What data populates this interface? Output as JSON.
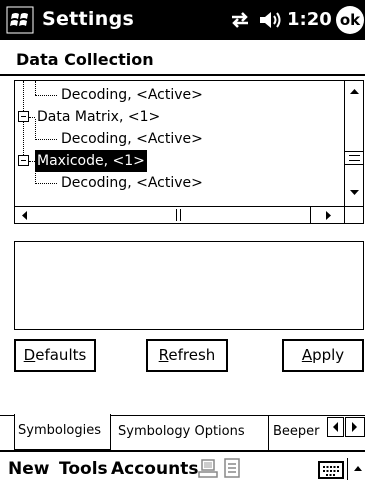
{
  "titlebar": {
    "title": "Settings",
    "time": "1:20",
    "ok_label": "ok",
    "start_icon": "windows-flag-icon",
    "connectivity_icon": "connectivity-icon",
    "volume_icon": "speaker-icon"
  },
  "page": {
    "title": "Data Collection"
  },
  "tree": {
    "rows": [
      {
        "label": "Decoding, <Active>",
        "level": 1
      },
      {
        "label": "Data Matrix, <1>",
        "level": 0,
        "expanded": true
      },
      {
        "label": "Decoding, <Active>",
        "level": 1
      },
      {
        "label": "Maxicode, <1>",
        "level": 0,
        "expanded": true,
        "selected": true
      },
      {
        "label": "Decoding, <Active>",
        "level": 1
      }
    ]
  },
  "text_panel": {
    "value": ""
  },
  "buttons": {
    "defaults": {
      "first": "D",
      "rest": "efaults"
    },
    "refresh": {
      "first": "R",
      "rest": "efresh"
    },
    "apply": {
      "first": "A",
      "rest": "pply"
    }
  },
  "tabs": [
    {
      "label": "Symbologies",
      "active": true
    },
    {
      "label": "Symbology Options",
      "active": false
    },
    {
      "label": "Beeper",
      "active": false
    }
  ],
  "menubar": {
    "items": [
      "New",
      "Tools",
      "Accounts"
    ],
    "icons": [
      "sync-icon",
      "document-icon",
      "keyboard-icon"
    ]
  }
}
